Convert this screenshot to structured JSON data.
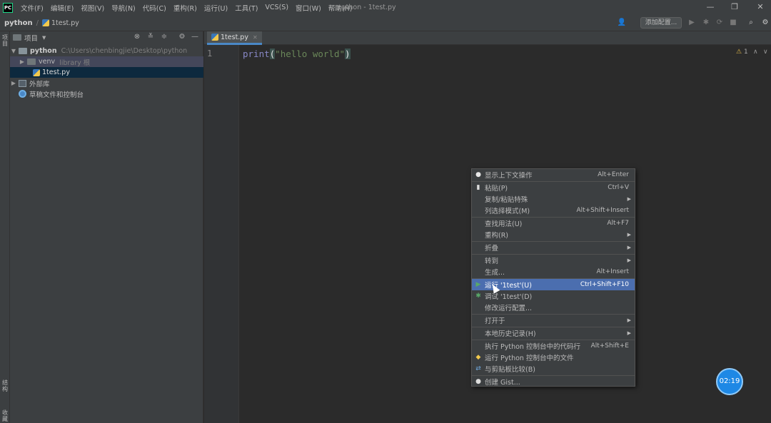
{
  "titlebar": {
    "logo": "PC",
    "menus": [
      "文件(F)",
      "编辑(E)",
      "视图(V)",
      "导航(N)",
      "代码(C)",
      "重构(R)",
      "运行(U)",
      "工具(T)",
      "VCS(S)",
      "窗口(W)",
      "帮助(H)"
    ],
    "window_title": "python - 1test.py"
  },
  "navbar": {
    "project": "python",
    "file": "1test.py",
    "add_config": "添加配置..."
  },
  "left_stripe": {
    "top_label": "项目",
    "bottom_label": "结构",
    "bottom_label2": "收藏"
  },
  "project_panel": {
    "title": "项目",
    "tree": {
      "root": {
        "name": "python",
        "path": "C:\\Users\\chenbingjie\\Desktop\\python"
      },
      "venv": {
        "name": "venv",
        "note": "library 根"
      },
      "file": {
        "name": "1test.py"
      },
      "external": {
        "name": "外部库"
      },
      "scratches": {
        "name": "草稿文件和控制台"
      }
    }
  },
  "editor": {
    "tab": "1test.py",
    "line_number": "1",
    "code": {
      "fn": "print",
      "open": "(",
      "str": "\"hello world\"",
      "close": ")"
    },
    "inspection_count": "1"
  },
  "context_menu": {
    "items": [
      {
        "label": "显示上下文操作",
        "shortcut": "Alt+Enter",
        "icon": "bulb-icon"
      },
      {
        "label": "粘贴(P)",
        "shortcut": "Ctrl+V",
        "icon": "paste-icon"
      },
      {
        "label": "复制/粘贴特殊",
        "shortcut": ""
      },
      {
        "label": "列选择模式(M)",
        "shortcut": "Alt+Shift+Insert"
      },
      {
        "label": "查找用法(U)",
        "shortcut": "Alt+F7"
      },
      {
        "label": "重构(R)",
        "shortcut": ""
      },
      {
        "label": "折叠",
        "shortcut": ""
      },
      {
        "label": "转到",
        "shortcut": ""
      },
      {
        "label": "生成...",
        "shortcut": "Alt+Insert"
      },
      {
        "label": "运行 '1test'(U)",
        "shortcut": "Ctrl+Shift+F10",
        "icon": "run-icon"
      },
      {
        "label": "调试 '1test'(D)",
        "shortcut": "",
        "icon": "debug-icon"
      },
      {
        "label": "修改运行配置...",
        "shortcut": ""
      },
      {
        "label": "打开于",
        "shortcut": ""
      },
      {
        "label": "本地历史记录(H)",
        "shortcut": ""
      },
      {
        "label": "执行 Python 控制台中的代码行",
        "shortcut": "Alt+Shift+E"
      },
      {
        "label": "运行 Python 控制台中的文件",
        "shortcut": "",
        "icon": "python-icon"
      },
      {
        "label": "与剪贴板比较(B)",
        "shortcut": "",
        "icon": "compare-icon"
      },
      {
        "label": "创建 Gist...",
        "shortcut": "",
        "icon": "github-icon"
      }
    ]
  },
  "timer_badge": "02:19",
  "colors": {
    "accent": "#4b6eaf",
    "selection": "#0d293e",
    "badge": "#1e88e5"
  }
}
